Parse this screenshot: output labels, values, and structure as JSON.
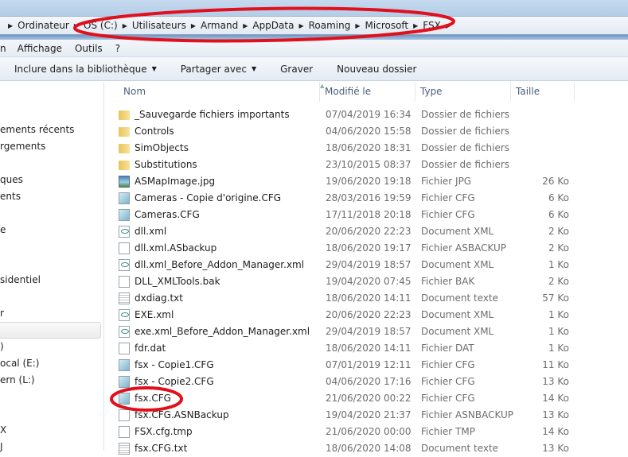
{
  "breadcrumb": [
    "Ordinateur",
    "OS (C:)",
    "Utilisateurs",
    "Armand",
    "AppData",
    "Roaming",
    "Microsoft",
    "FSX"
  ],
  "menu": [
    "n",
    "Affichage",
    "Outils",
    "?"
  ],
  "toolbar": {
    "include": "Inclure dans la bibliothèque",
    "share": "Partager avec",
    "burn": "Graver",
    "new_folder": "Nouveau dossier"
  },
  "sidebar": [
    "ements récents",
    "rgements",
    "ques",
    "ents",
    "e",
    "sidentiel",
    "r",
    "",
    ")",
    "ocal (E:)",
    "ern (L:)",
    "X",
    "J"
  ],
  "columns": {
    "name": "Nom",
    "modified": "Modifié le",
    "type": "Type",
    "size": "Taille"
  },
  "files": [
    {
      "name": "_Sauvegarde fichiers importants",
      "date": "07/04/2019 16:34",
      "type": "Dossier de fichiers",
      "size": "",
      "icon": "folder"
    },
    {
      "name": "Controls",
      "date": "04/06/2020 15:58",
      "type": "Dossier de fichiers",
      "size": "",
      "icon": "folder"
    },
    {
      "name": "SimObjects",
      "date": "18/06/2020 18:31",
      "type": "Dossier de fichiers",
      "size": "",
      "icon": "folder"
    },
    {
      "name": "Substitutions",
      "date": "23/10/2015 08:37",
      "type": "Dossier de fichiers",
      "size": "",
      "icon": "folder"
    },
    {
      "name": "ASMapImage.jpg",
      "date": "19/06/2020 19:18",
      "type": "Fichier JPG",
      "size": "26 Ko",
      "icon": "jpg"
    },
    {
      "name": "Cameras - Copie d'origine.CFG",
      "date": "28/03/2016 19:59",
      "type": "Fichier CFG",
      "size": "6 Ko",
      "icon": "cfg"
    },
    {
      "name": "Cameras.CFG",
      "date": "17/11/2018 20:18",
      "type": "Fichier CFG",
      "size": "6 Ko",
      "icon": "cfg"
    },
    {
      "name": "dll.xml",
      "date": "20/06/2020 22:23",
      "type": "Document XML",
      "size": "2 Ko",
      "icon": "xml"
    },
    {
      "name": "dll.xml.ASbackup",
      "date": "18/06/2020 19:17",
      "type": "Fichier ASBACKUP",
      "size": "2 Ko",
      "icon": "file"
    },
    {
      "name": "dll.xml_Before_Addon_Manager.xml",
      "date": "29/04/2019 18:57",
      "type": "Document XML",
      "size": "1 Ko",
      "icon": "xml"
    },
    {
      "name": "DLL_XMLTools.bak",
      "date": "19/04/2020 07:45",
      "type": "Fichier BAK",
      "size": "2 Ko",
      "icon": "file"
    },
    {
      "name": "dxdiag.txt",
      "date": "18/06/2020 14:11",
      "type": "Document texte",
      "size": "57 Ko",
      "icon": "txt"
    },
    {
      "name": "EXE.xml",
      "date": "20/06/2020 22:23",
      "type": "Document XML",
      "size": "1 Ko",
      "icon": "xml"
    },
    {
      "name": "exe.xml_Before_Addon_Manager.xml",
      "date": "29/04/2019 18:57",
      "type": "Document XML",
      "size": "1 Ko",
      "icon": "xml"
    },
    {
      "name": "fdr.dat",
      "date": "18/06/2020 14:11",
      "type": "Fichier DAT",
      "size": "1 Ko",
      "icon": "file"
    },
    {
      "name": "fsx - Copie1.CFG",
      "date": "07/01/2019 12:11",
      "type": "Fichier CFG",
      "size": "11 Ko",
      "icon": "cfg"
    },
    {
      "name": "fsx - Copie2.CFG",
      "date": "04/06/2020 17:16",
      "type": "Fichier CFG",
      "size": "13 Ko",
      "icon": "cfg"
    },
    {
      "name": "fsx.CFG",
      "date": "21/06/2020 00:22",
      "type": "Fichier CFG",
      "size": "14 Ko",
      "icon": "cfg"
    },
    {
      "name": "fsx.CFG.ASNBackup",
      "date": "19/04/2020 21:37",
      "type": "Fichier ASNBACKUP",
      "size": "13 Ko",
      "icon": "file"
    },
    {
      "name": "FSX.cfg.tmp",
      "date": "21/06/2020 00:00",
      "type": "Fichier TMP",
      "size": "14 Ko",
      "icon": "file"
    },
    {
      "name": "fsx.CFG.txt",
      "date": "18/06/2020 14:08",
      "type": "Document texte",
      "size": "13 Ko",
      "icon": "txt"
    }
  ],
  "colors": {
    "annotation": "#e0101c",
    "title_bar": "#b4cde8"
  }
}
